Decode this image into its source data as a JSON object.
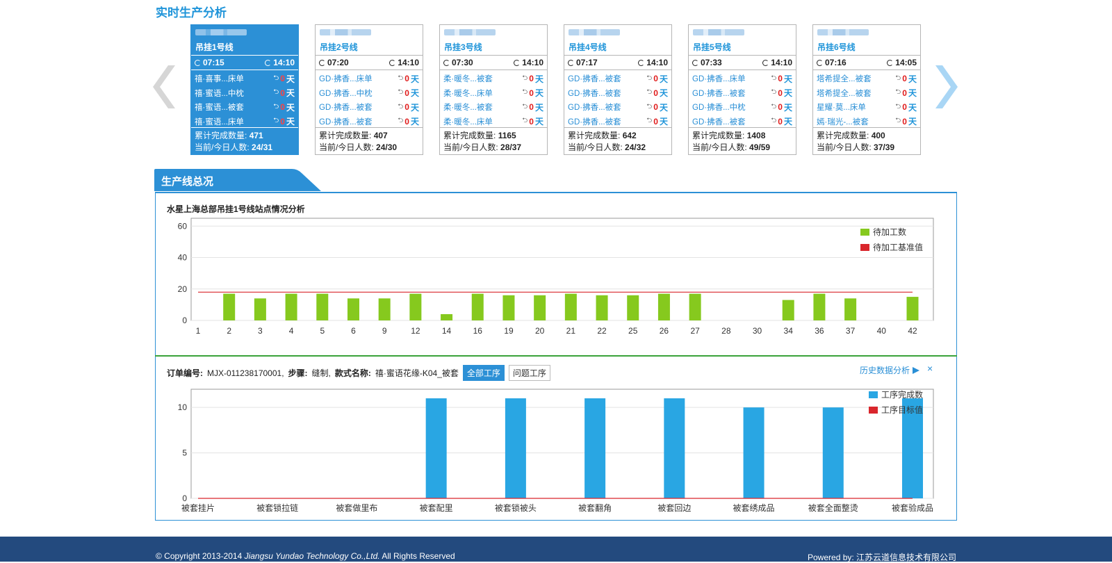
{
  "page_title": "实时生产分析",
  "lines": [
    {
      "name": "吊挂1号线",
      "start": "07:15",
      "end": "14:10",
      "orders": [
        {
          "name": "禧·喜事...床单",
          "days": "0",
          "unit": "天"
        },
        {
          "name": "禧·蜜语...中枕",
          "days": "0",
          "unit": "天"
        },
        {
          "name": "禧·蜜语...被套",
          "days": "0",
          "unit": "天"
        },
        {
          "name": "禧·蜜语...床单",
          "days": "0",
          "unit": "天"
        }
      ],
      "completed_label": "累计完成数量:",
      "completed": "471",
      "people_label": "当前/今日人数:",
      "people": "24/31",
      "active": true
    },
    {
      "name": "吊挂2号线",
      "start": "07:20",
      "end": "14:10",
      "orders": [
        {
          "name": "GD·拂香...床单",
          "days": "0",
          "unit": "天"
        },
        {
          "name": "GD·拂香...中枕",
          "days": "0",
          "unit": "天"
        },
        {
          "name": "GD·拂香...被套",
          "days": "0",
          "unit": "天"
        },
        {
          "name": "GD·拂香...被套",
          "days": "0",
          "unit": "天"
        }
      ],
      "completed_label": "累计完成数量:",
      "completed": "407",
      "people_label": "当前/今日人数:",
      "people": "24/30",
      "active": false
    },
    {
      "name": "吊挂3号线",
      "start": "07:30",
      "end": "14:10",
      "orders": [
        {
          "name": "柔·暖冬...被套",
          "days": "0",
          "unit": "天"
        },
        {
          "name": "柔·暖冬...床单",
          "days": "0",
          "unit": "天"
        },
        {
          "name": "柔·暖冬...被套",
          "days": "0",
          "unit": "天"
        },
        {
          "name": "柔·暖冬...床单",
          "days": "0",
          "unit": "天"
        }
      ],
      "completed_label": "累计完成数量:",
      "completed": "1165",
      "people_label": "当前/今日人数:",
      "people": "28/37",
      "active": false
    },
    {
      "name": "吊挂4号线",
      "start": "07:17",
      "end": "14:10",
      "orders": [
        {
          "name": "GD·拂香...被套",
          "days": "0",
          "unit": "天"
        },
        {
          "name": "GD·拂香...被套",
          "days": "0",
          "unit": "天"
        },
        {
          "name": "GD·拂香...被套",
          "days": "0",
          "unit": "天"
        },
        {
          "name": "GD·拂香...被套",
          "days": "0",
          "unit": "天"
        }
      ],
      "completed_label": "累计完成数量:",
      "completed": "642",
      "people_label": "当前/今日人数:",
      "people": "24/32",
      "active": false
    },
    {
      "name": "吊挂5号线",
      "start": "07:33",
      "end": "14:10",
      "orders": [
        {
          "name": "GD·拂香...床单",
          "days": "0",
          "unit": "天"
        },
        {
          "name": "GD·拂香...被套",
          "days": "0",
          "unit": "天"
        },
        {
          "name": "GD·拂香...中枕",
          "days": "0",
          "unit": "天"
        },
        {
          "name": "GD·拂香...被套",
          "days": "0",
          "unit": "天"
        }
      ],
      "completed_label": "累计完成数量:",
      "completed": "1408",
      "people_label": "当前/今日人数:",
      "people": "49/59",
      "active": false
    },
    {
      "name": "吊挂6号线",
      "start": "07:16",
      "end": "14:05",
      "orders": [
        {
          "name": "塔希提全...被套",
          "days": "0",
          "unit": "天"
        },
        {
          "name": "塔希提全...被套",
          "days": "0",
          "unit": "天"
        },
        {
          "name": "星耀·莫...床单",
          "days": "0",
          "unit": "天"
        },
        {
          "name": "嫣·瑞光-...被套",
          "days": "0",
          "unit": "天"
        }
      ],
      "completed_label": "累计完成数量:",
      "completed": "400",
      "people_label": "当前/今日人数:",
      "people": "37/39",
      "active": false
    }
  ],
  "section_title": "生产线总况",
  "chart1_title": "水星上海总部吊挂1号线站点情况分析",
  "order_info": {
    "order_label": "订单编号:",
    "order_no": "MJX-011238170001,",
    "step_label": "步骤:",
    "step": "缝制,",
    "style_label": "款式名称:",
    "style": "禧·蜜语花缘-K04_被套",
    "btn_all": "全部工序",
    "btn_problem": "问题工序",
    "history": "历史数据分析",
    "close": "×"
  },
  "footer": {
    "copyright_prefix": "© Copyright 2013-2014 ",
    "company_en": "Jiangsu Yundao Technology Co.,Ltd.",
    "rights": " All Rights Reserved",
    "powered_label": "Powered by: ",
    "powered_company": "江苏云道信息技术有限公司"
  },
  "colors": {
    "primary": "#2c90d6",
    "bar_green": "#86c91e",
    "bar_blue": "#29a6e3",
    "ref_red": "#d9262c",
    "footer": "#234a7e"
  },
  "chart_data": [
    {
      "type": "bar",
      "title": "水星上海总部吊挂1号线站点情况分析",
      "categories": [
        "1",
        "2",
        "3",
        "4",
        "5",
        "6",
        "9",
        "12",
        "14",
        "16",
        "19",
        "20",
        "21",
        "22",
        "25",
        "26",
        "27",
        "28",
        "30",
        "34",
        "36",
        "37",
        "40",
        "42"
      ],
      "series": [
        {
          "name": "待加工数",
          "type": "bar",
          "color": "#86c91e",
          "values": [
            0,
            17,
            14,
            17,
            17,
            14,
            14,
            17,
            4,
            17,
            16,
            16,
            17,
            16,
            16,
            17,
            17,
            0,
            0,
            13,
            17,
            14,
            0,
            15
          ]
        },
        {
          "name": "待加工基准值",
          "type": "line",
          "color": "#d9262c",
          "values": [
            18,
            18,
            18,
            18,
            18,
            18,
            18,
            18,
            18,
            18,
            18,
            18,
            18,
            18,
            18,
            18,
            18,
            18,
            18,
            18,
            18,
            18,
            18,
            18
          ]
        }
      ],
      "yticks": [
        0,
        20,
        40,
        60
      ],
      "ylim": [
        0,
        65
      ],
      "legend": "top-right",
      "grid": true
    },
    {
      "type": "bar",
      "categories": [
        "被套挂片",
        "被套锁拉链",
        "被套做里布",
        "被套配里",
        "被套锁被头",
        "被套翻角",
        "被套回边",
        "被套绣成品",
        "被套全面整烫",
        "被套验成品"
      ],
      "series": [
        {
          "name": "工序完成数",
          "type": "bar",
          "color": "#29a6e3",
          "values": [
            0,
            0,
            0,
            11,
            11,
            11,
            11,
            10,
            10,
            11
          ]
        },
        {
          "name": "工序目标值",
          "type": "line",
          "color": "#d9262c",
          "values": [
            0,
            0,
            0,
            0,
            0,
            0,
            0,
            0,
            0,
            0
          ]
        }
      ],
      "yticks": [
        0,
        5,
        10
      ],
      "ylim": [
        0,
        12
      ],
      "legend": "top-right",
      "grid": true
    }
  ]
}
